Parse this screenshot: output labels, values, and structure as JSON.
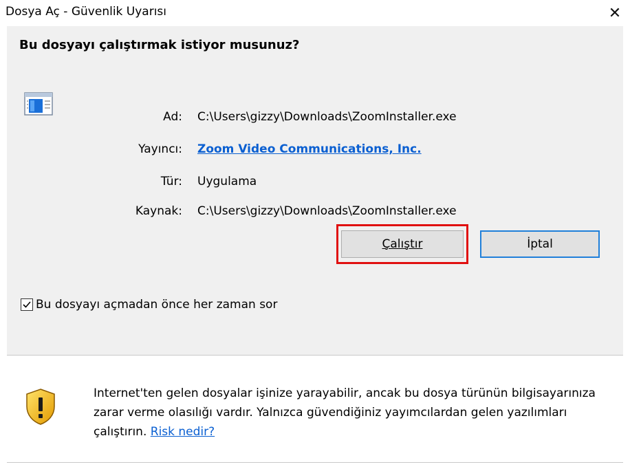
{
  "window": {
    "title": "Dosya Aç - Güvenlik Uyarısı",
    "close_glyph": "✕"
  },
  "dialog": {
    "question": "Bu dosyayı çalıştırmak istiyor musunuz?",
    "fields": [
      {
        "label": "Ad:",
        "value": "C:\\Users\\gizzy\\Downloads\\ZoomInstaller.exe"
      },
      {
        "label": "Yayıncı:",
        "value": "Zoom Video Communications, Inc."
      },
      {
        "label": "Tür:",
        "value": "Uygulama"
      },
      {
        "label": "Kaynak:",
        "value": "C:\\Users\\gizzy\\Downloads\\ZoomInstaller.exe"
      }
    ],
    "run_button": "Çalıştır",
    "cancel_button": "İptal",
    "checkbox_label": "Bu dosyayı açmadan önce her zaman sor",
    "checkbox_checked": true
  },
  "warning": {
    "text": "Internet'ten gelen dosyalar işinize yarayabilir, ancak bu dosya türünün bilgisayarınıza zarar verme olasılığı vardır. Yalnızca güvendiğiniz yayımcılardan gelen yazılımları çalıştırın. ",
    "link": "Risk nedir?"
  },
  "colors": {
    "link": "#0a5fd1",
    "highlight": "#e01010",
    "panel": "#f0f0f0"
  }
}
